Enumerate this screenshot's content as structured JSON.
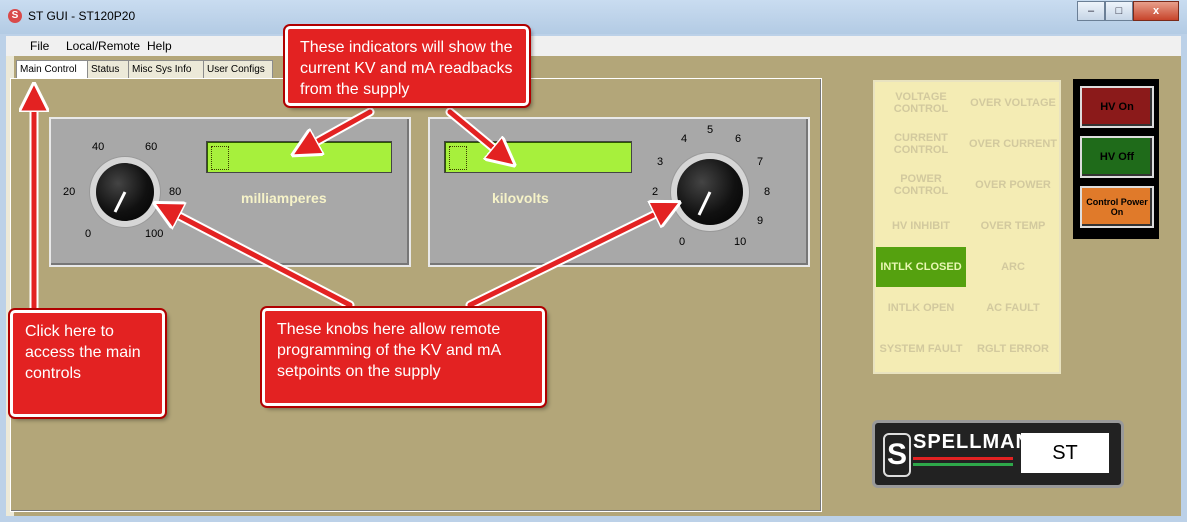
{
  "window": {
    "title": "ST GUI - ST120P20",
    "app_icon": "S",
    "controls": {
      "minimize": "–",
      "maximize": "□",
      "close": "x"
    }
  },
  "menu": [
    "File",
    "Local/Remote",
    "Help"
  ],
  "tabs": [
    {
      "label": "Main Control",
      "active": true
    },
    {
      "label": "Status",
      "active": false
    },
    {
      "label": "Misc Sys Info",
      "active": false
    },
    {
      "label": "User Configs",
      "active": false
    }
  ],
  "ma_panel": {
    "label": "milliamperes",
    "ticks": [
      "0",
      "20",
      "40",
      "60",
      "80",
      "100"
    ]
  },
  "kv_panel": {
    "label": "kilovolts",
    "ticks": [
      "0",
      "2",
      "3",
      "4",
      "5",
      "6",
      "7",
      "8",
      "9",
      "10"
    ]
  },
  "status_grid": [
    {
      "label": "VOLTAGE CONTROL",
      "active": false
    },
    {
      "label": "OVER VOLTAGE",
      "active": false
    },
    {
      "label": "CURRENT CONTROL",
      "active": false
    },
    {
      "label": "OVER CURRENT",
      "active": false
    },
    {
      "label": "POWER CONTROL",
      "active": false
    },
    {
      "label": "OVER POWER",
      "active": false
    },
    {
      "label": "HV INHIBIT",
      "active": false
    },
    {
      "label": "OVER TEMP",
      "active": false
    },
    {
      "label": "INTLK CLOSED",
      "active": true
    },
    {
      "label": "ARC",
      "active": false
    },
    {
      "label": "INTLK OPEN",
      "active": false
    },
    {
      "label": "AC FAULT",
      "active": false
    },
    {
      "label": "SYSTEM FAULT",
      "active": false
    },
    {
      "label": "RGLT ERROR",
      "active": false
    }
  ],
  "hv_controls": {
    "hv_on": "HV On",
    "hv_off": "HV Off",
    "control_power": "Control Power On"
  },
  "logo": {
    "brand": "SPELLMAN",
    "model": "ST"
  },
  "callouts": {
    "indicators": "These indicators will show the current KV and mA readbacks from the supply",
    "main_controls": "Click here to access the main controls",
    "knobs": "These knobs here allow remote programming of the KV and mA setpoints on the supply"
  },
  "colors": {
    "background": "#b3a679",
    "readout": "#a7f03c",
    "callout": "#e32222",
    "intlk_closed": "#55a10f",
    "hv_on": "#8b1a1a",
    "hv_off": "#1f6b1a",
    "control_power": "#e07a2a"
  }
}
